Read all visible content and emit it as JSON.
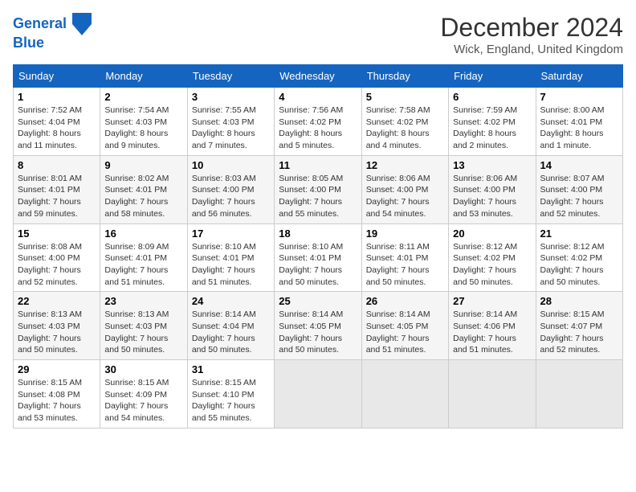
{
  "logo": {
    "line1": "General",
    "line2": "Blue"
  },
  "title": "December 2024",
  "location": "Wick, England, United Kingdom",
  "days_of_week": [
    "Sunday",
    "Monday",
    "Tuesday",
    "Wednesday",
    "Thursday",
    "Friday",
    "Saturday"
  ],
  "weeks": [
    [
      {
        "day": "1",
        "sunrise": "7:52 AM",
        "sunset": "4:04 PM",
        "daylight": "8 hours and 11 minutes."
      },
      {
        "day": "2",
        "sunrise": "7:54 AM",
        "sunset": "4:03 PM",
        "daylight": "8 hours and 9 minutes."
      },
      {
        "day": "3",
        "sunrise": "7:55 AM",
        "sunset": "4:03 PM",
        "daylight": "8 hours and 7 minutes."
      },
      {
        "day": "4",
        "sunrise": "7:56 AM",
        "sunset": "4:02 PM",
        "daylight": "8 hours and 5 minutes."
      },
      {
        "day": "5",
        "sunrise": "7:58 AM",
        "sunset": "4:02 PM",
        "daylight": "8 hours and 4 minutes."
      },
      {
        "day": "6",
        "sunrise": "7:59 AM",
        "sunset": "4:02 PM",
        "daylight": "8 hours and 2 minutes."
      },
      {
        "day": "7",
        "sunrise": "8:00 AM",
        "sunset": "4:01 PM",
        "daylight": "8 hours and 1 minute."
      }
    ],
    [
      {
        "day": "8",
        "sunrise": "8:01 AM",
        "sunset": "4:01 PM",
        "daylight": "7 hours and 59 minutes."
      },
      {
        "day": "9",
        "sunrise": "8:02 AM",
        "sunset": "4:01 PM",
        "daylight": "7 hours and 58 minutes."
      },
      {
        "day": "10",
        "sunrise": "8:03 AM",
        "sunset": "4:00 PM",
        "daylight": "7 hours and 56 minutes."
      },
      {
        "day": "11",
        "sunrise": "8:05 AM",
        "sunset": "4:00 PM",
        "daylight": "7 hours and 55 minutes."
      },
      {
        "day": "12",
        "sunrise": "8:06 AM",
        "sunset": "4:00 PM",
        "daylight": "7 hours and 54 minutes."
      },
      {
        "day": "13",
        "sunrise": "8:06 AM",
        "sunset": "4:00 PM",
        "daylight": "7 hours and 53 minutes."
      },
      {
        "day": "14",
        "sunrise": "8:07 AM",
        "sunset": "4:00 PM",
        "daylight": "7 hours and 52 minutes."
      }
    ],
    [
      {
        "day": "15",
        "sunrise": "8:08 AM",
        "sunset": "4:00 PM",
        "daylight": "7 hours and 52 minutes."
      },
      {
        "day": "16",
        "sunrise": "8:09 AM",
        "sunset": "4:01 PM",
        "daylight": "7 hours and 51 minutes."
      },
      {
        "day": "17",
        "sunrise": "8:10 AM",
        "sunset": "4:01 PM",
        "daylight": "7 hours and 51 minutes."
      },
      {
        "day": "18",
        "sunrise": "8:10 AM",
        "sunset": "4:01 PM",
        "daylight": "7 hours and 50 minutes."
      },
      {
        "day": "19",
        "sunrise": "8:11 AM",
        "sunset": "4:01 PM",
        "daylight": "7 hours and 50 minutes."
      },
      {
        "day": "20",
        "sunrise": "8:12 AM",
        "sunset": "4:02 PM",
        "daylight": "7 hours and 50 minutes."
      },
      {
        "day": "21",
        "sunrise": "8:12 AM",
        "sunset": "4:02 PM",
        "daylight": "7 hours and 50 minutes."
      }
    ],
    [
      {
        "day": "22",
        "sunrise": "8:13 AM",
        "sunset": "4:03 PM",
        "daylight": "7 hours and 50 minutes."
      },
      {
        "day": "23",
        "sunrise": "8:13 AM",
        "sunset": "4:03 PM",
        "daylight": "7 hours and 50 minutes."
      },
      {
        "day": "24",
        "sunrise": "8:14 AM",
        "sunset": "4:04 PM",
        "daylight": "7 hours and 50 minutes."
      },
      {
        "day": "25",
        "sunrise": "8:14 AM",
        "sunset": "4:05 PM",
        "daylight": "7 hours and 50 minutes."
      },
      {
        "day": "26",
        "sunrise": "8:14 AM",
        "sunset": "4:05 PM",
        "daylight": "7 hours and 51 minutes."
      },
      {
        "day": "27",
        "sunrise": "8:14 AM",
        "sunset": "4:06 PM",
        "daylight": "7 hours and 51 minutes."
      },
      {
        "day": "28",
        "sunrise": "8:15 AM",
        "sunset": "4:07 PM",
        "daylight": "7 hours and 52 minutes."
      }
    ],
    [
      {
        "day": "29",
        "sunrise": "8:15 AM",
        "sunset": "4:08 PM",
        "daylight": "7 hours and 53 minutes."
      },
      {
        "day": "30",
        "sunrise": "8:15 AM",
        "sunset": "4:09 PM",
        "daylight": "7 hours and 54 minutes."
      },
      {
        "day": "31",
        "sunrise": "8:15 AM",
        "sunset": "4:10 PM",
        "daylight": "7 hours and 55 minutes."
      },
      null,
      null,
      null,
      null
    ]
  ]
}
